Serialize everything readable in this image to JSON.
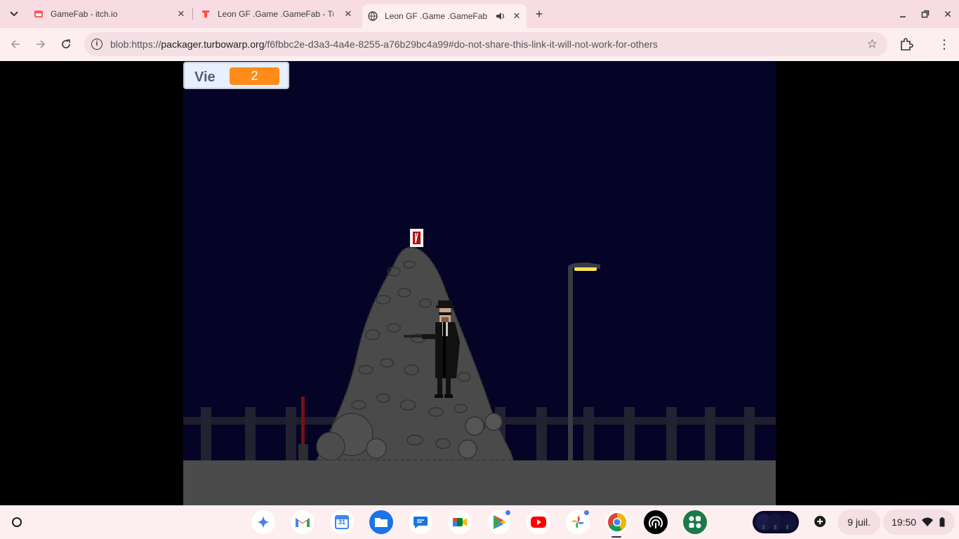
{
  "browser": {
    "tabs": [
      {
        "title": "GameFab - itch.io",
        "active": false
      },
      {
        "title": "Leon GF .Game .GameFab - Tu",
        "active": false
      },
      {
        "title": "Leon GF .Game .GameFab",
        "active": true,
        "audio": true
      }
    ],
    "url": {
      "prefix": "blob:https://",
      "host": "packager.turbowarp.org",
      "rest": "/f6fbbc2e-d3a3-4a4e-8255-a76b29bc4a99#do-not-share-this-link-it-will-not-work-for-others"
    }
  },
  "game": {
    "variable_label": "Vie",
    "variable_value": "2",
    "colors": {
      "sky": "#050326",
      "ground": "#4b4b4b",
      "monitor_value": "#ff8c1a",
      "lamp_light": "#ffe34d"
    }
  },
  "taskbar": {
    "apps": [
      "gemini-icon",
      "gmail-icon",
      "calendar-icon",
      "files-icon",
      "messages-icon",
      "meet-icon",
      "play-store-icon",
      "youtube-icon",
      "photos-icon",
      "chrome-icon",
      "signal-app-icon",
      "apps-icon"
    ],
    "calendar_day": "31",
    "date": "9 juil.",
    "time": "19:50"
  }
}
